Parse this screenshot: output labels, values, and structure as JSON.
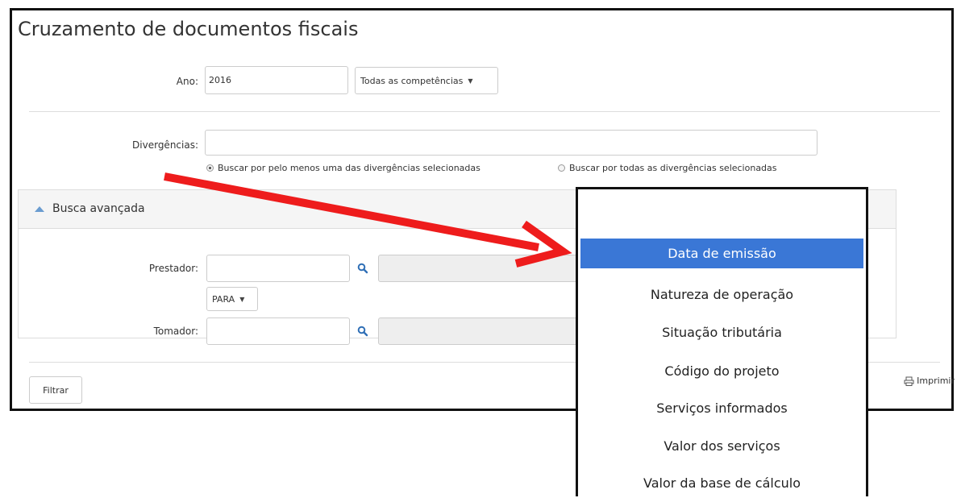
{
  "page": {
    "title": "Cruzamento de documentos fiscais"
  },
  "filters": {
    "ano_label": "Ano:",
    "ano_value": "2016",
    "competencias_label": "Todas as competências",
    "divergencias_label": "Divergências:",
    "divergencias_value": "",
    "radio_any_label": "Buscar por pelo menos uma das divergências selecionadas",
    "radio_all_label": "Buscar por todas as divergências selecionadas",
    "radio_selected": "any"
  },
  "advanced": {
    "title": "Busca avançada",
    "prestador_label": "Prestador:",
    "prestador_value": "",
    "para_label": "PARA",
    "tomador_label": "Tomador:",
    "tomador_value": ""
  },
  "actions": {
    "filter_label": "Filtrar",
    "print_label": "Imprimir"
  },
  "dropdown": {
    "items": [
      "Data de emissão",
      "Natureza de operação",
      "Situação tributária",
      "Código do projeto",
      "Serviços informados",
      "Valor dos serviços",
      "Valor da base de cálculo"
    ],
    "highlighted_index": 0
  },
  "colors": {
    "highlight": "#3a77d6",
    "arrow": "#ee1c1c",
    "accent_icon": "#6a9cd0"
  },
  "icons": {
    "search": "magnifier-icon",
    "print": "printer-icon",
    "collapse": "triangle-up-icon"
  }
}
